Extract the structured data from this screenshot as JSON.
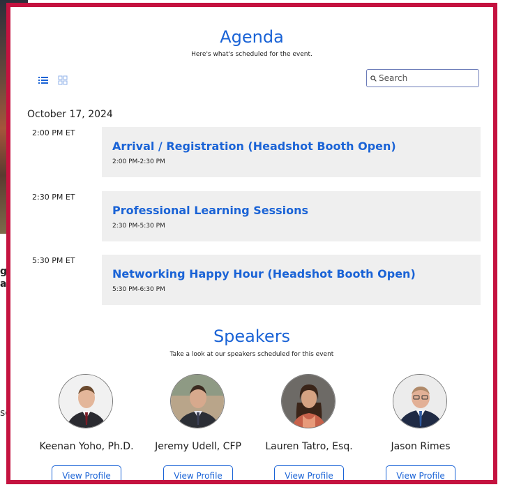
{
  "background": {
    "text1": "gu\na",
    "text2": "se"
  },
  "agenda": {
    "title": "Agenda",
    "subtitle": "Here's what's scheduled for the event.",
    "search_placeholder": "Search",
    "date": "October 17, 2024",
    "items": [
      {
        "time": "2:00 PM ET",
        "title": "Arrival / Registration (Headshot Booth Open)",
        "range": "2:00 PM-2:30 PM"
      },
      {
        "time": "2:30 PM ET",
        "title": "Professional Learning Sessions",
        "range": "2:30 PM-5:30 PM"
      },
      {
        "time": "5:30 PM ET",
        "title": "Networking Happy Hour (Headshot Booth Open)",
        "range": "5:30 PM-6:30 PM"
      }
    ]
  },
  "speakers": {
    "title": "Speakers",
    "subtitle": "Take a look at our speakers scheduled for this event",
    "button_label": "View Profile",
    "list": [
      {
        "name": "Keenan Yoho, Ph.D."
      },
      {
        "name": "Jeremy Udell, CFP"
      },
      {
        "name": "Lauren Tatro, Esq."
      },
      {
        "name": "Jason Rimes"
      }
    ]
  },
  "colors": {
    "accent": "#1a63d6",
    "border": "#c4123f",
    "card_bg": "#efefef"
  }
}
